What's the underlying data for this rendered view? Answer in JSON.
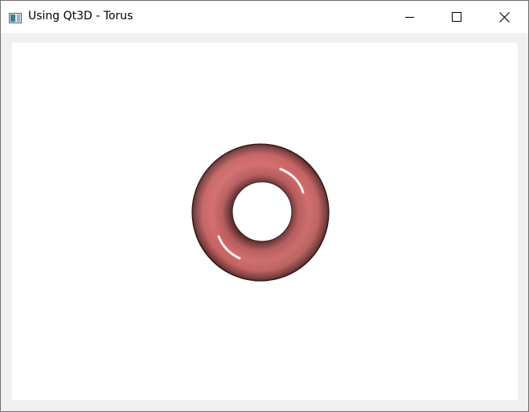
{
  "window": {
    "title": "Using Qt3D - Torus",
    "icon": "qt-app-window-icon"
  },
  "caption_buttons": {
    "minimize_icon": "minimize-icon",
    "maximize_icon": "maximize-icon",
    "close_icon": "close-icon"
  },
  "scene": {
    "object": "torus",
    "colors": {
      "torus_base": "#d06868",
      "torus_dark": "#3a1c1c",
      "highlight": "#ffffff",
      "viewport_background": "#ffffff"
    }
  }
}
